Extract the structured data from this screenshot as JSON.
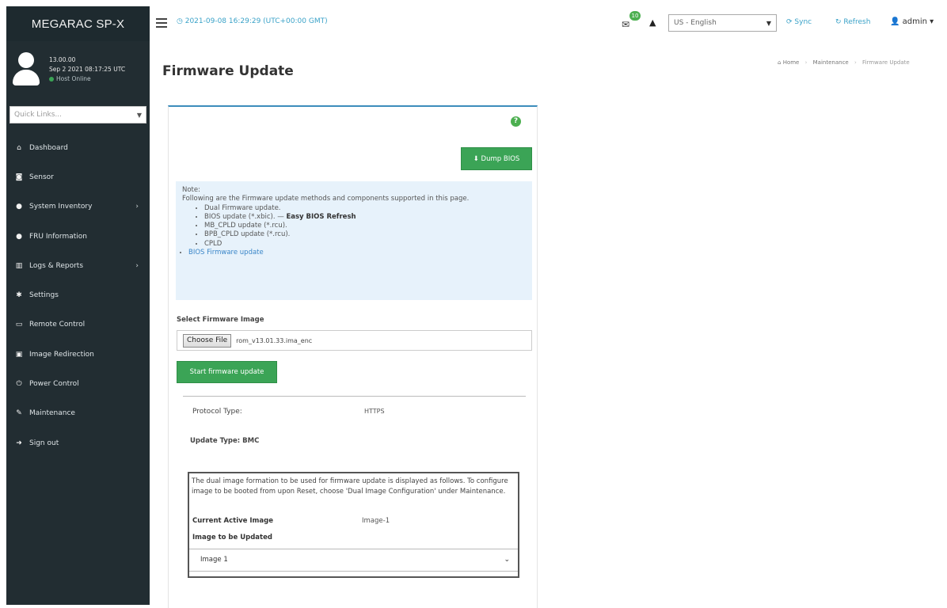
{
  "sidebar": {
    "brand": "MEGARAC SP-X",
    "user": {
      "name": "13.00.00",
      "datetime": "Sep 2 2021 08:17:25 UTC",
      "status": "Host Online"
    },
    "quick_links_placeholder": "Quick Links...",
    "items": [
      {
        "label": "Dashboard",
        "icon": "home-icon",
        "glyph": "⌂",
        "has_arrow": false
      },
      {
        "label": "Sensor",
        "icon": "sensor-icon",
        "glyph": "◙",
        "has_arrow": false
      },
      {
        "label": "System Inventory",
        "icon": "inventory-icon",
        "glyph": "●",
        "has_arrow": true
      },
      {
        "label": "FRU Information",
        "icon": "info-icon",
        "glyph": "●",
        "has_arrow": false
      },
      {
        "label": "Logs & Reports",
        "icon": "chart-icon",
        "glyph": "▥",
        "has_arrow": true
      },
      {
        "label": "Settings",
        "icon": "gear-icon",
        "glyph": "✱",
        "has_arrow": false
      },
      {
        "label": "Remote Control",
        "icon": "monitor-icon",
        "glyph": "▭",
        "has_arrow": false
      },
      {
        "label": "Image Redirection",
        "icon": "media-icon",
        "glyph": "▣",
        "has_arrow": false
      },
      {
        "label": "Power Control",
        "icon": "power-icon",
        "glyph": "⏻",
        "has_arrow": false
      },
      {
        "label": "Maintenance",
        "icon": "wrench-icon",
        "glyph": "✎",
        "has_arrow": false
      },
      {
        "label": "Sign out",
        "icon": "signout-icon",
        "glyph": "➜",
        "has_arrow": false
      }
    ]
  },
  "topbar": {
    "datetime": "2021-09-08 16:29:29 (UTC+00:00 GMT)",
    "notification_count": "10",
    "language": "US - English",
    "sync_label": "Sync",
    "refresh_label": "Refresh",
    "user_label": "admin"
  },
  "header": {
    "title": "Firmware Update",
    "breadcrumbs": [
      "Home",
      "Maintenance",
      "Firmware Update"
    ]
  },
  "panel": {
    "dump_bios_label": "Dump BIOS",
    "note": {
      "title": "Note:",
      "intro": "Following are the Firmware update methods and components supported in this page.",
      "items": [
        "Dual Firmware update.",
        "BIOS update (*.xbic). —",
        "MB_CPLD update (*.rcu).",
        "BPB_CPLD update (*.rcu).",
        "CPLD"
      ],
      "easy_bios_link": "Easy BIOS Refresh",
      "bios_firmware_link": "BIOS Firmware update"
    },
    "select_label": "Select Firmware Image",
    "choose_file_label": "Choose File",
    "file_name": "rom_v13.01.33.ima_enc",
    "start_label": "Start firmware update",
    "protocol_label": "Protocol Type:",
    "protocol_value": "HTTPS",
    "update_type": "Update Type: BMC",
    "dual_text": "The dual image formation to be used for firmware update is displayed as follows. To configure image to be booted from upon Reset, choose 'Dual Image Configuration' under Maintenance.",
    "current_active_label": "Current Active Image",
    "current_active_value": "Image-1",
    "to_update_label": "Image to be Updated",
    "image_select_value": "Image 1"
  },
  "colors": {
    "sidebar_bg": "#222d32",
    "accent_green": "#3ba456",
    "link_blue": "#3aa2c8",
    "note_bg": "#e7f2fb"
  }
}
